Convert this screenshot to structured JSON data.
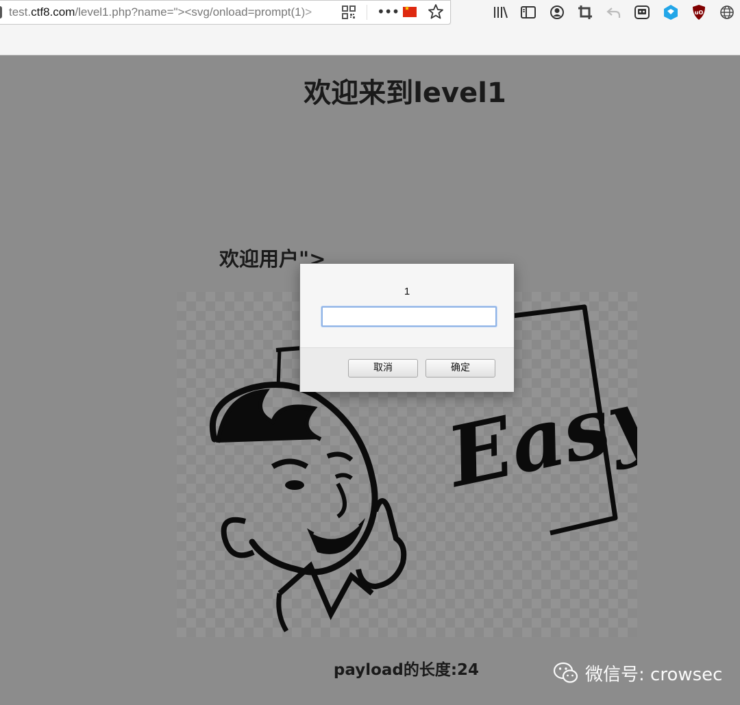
{
  "browser": {
    "url_prefix": "test.",
    "url_host": "ctf8.com",
    "url_path": "/level1.php?name=\"><svg/onload=prompt(1)>"
  },
  "page": {
    "title": "欢迎来到level1",
    "welcome": "欢迎用户\">",
    "payload_length": "payload的长度:24"
  },
  "hero_image": {
    "text": "Easy"
  },
  "dialog": {
    "message": "1",
    "input_value": "",
    "cancel_label": "取消",
    "ok_label": "确定"
  },
  "watermark": {
    "text": "微信号: crowsec"
  }
}
